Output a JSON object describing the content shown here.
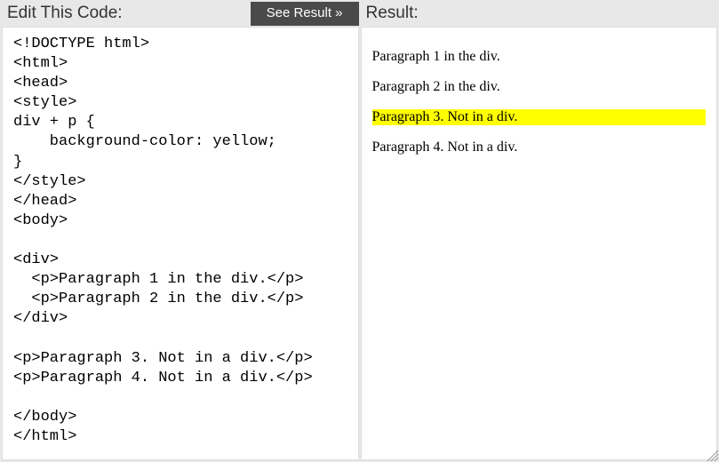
{
  "editor": {
    "header": "Edit This Code:",
    "see_result_label": "See Result »",
    "code": "<!DOCTYPE html>\n<html>\n<head>\n<style>\ndiv + p {\n    background-color: yellow;\n}\n</style>\n</head>\n<body>\n\n<div>\n  <p>Paragraph 1 in the div.</p>\n  <p>Paragraph 2 in the div.</p>\n</div>\n\n<p>Paragraph 3. Not in a div.</p>\n<p>Paragraph 4. Not in a div.</p>\n\n</body>\n</html>"
  },
  "result": {
    "header": "Result:",
    "paragraphs": [
      {
        "text": "Paragraph 1 in the div.",
        "highlighted": false
      },
      {
        "text": "Paragraph 2 in the div.",
        "highlighted": false
      },
      {
        "text": "Paragraph 3. Not in a div.",
        "highlighted": true
      },
      {
        "text": "Paragraph 4. Not in a div.",
        "highlighted": false
      }
    ]
  }
}
